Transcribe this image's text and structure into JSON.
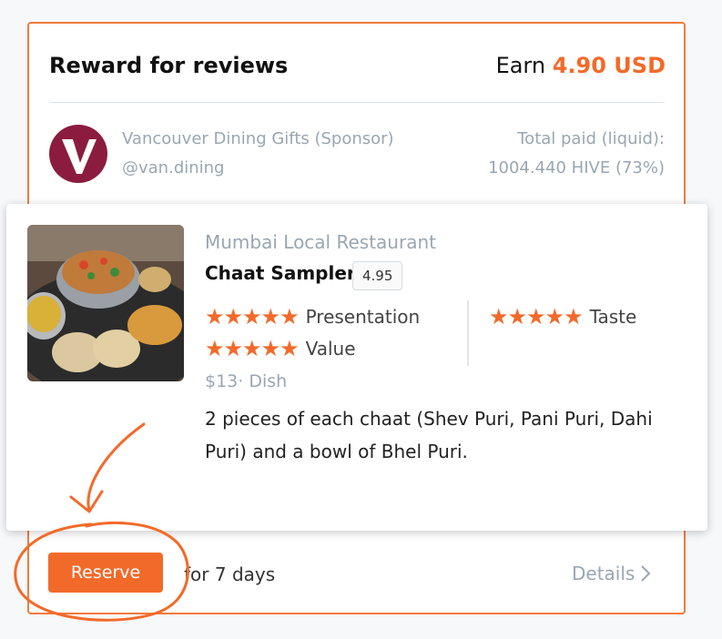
{
  "reward": {
    "title": "Reward for reviews",
    "earn_prefix": "Earn",
    "earn_amount": "4.90 USD"
  },
  "sponsor": {
    "name": "Vancouver Dining Gifts (Sponsor)",
    "handle": "@van.dining",
    "total_paid_label": "Total paid (liquid):",
    "total_paid_value": "1004.440 HIVE (73%)",
    "avatar_letter": "V"
  },
  "item": {
    "restaurant": "Mumbai Local Restaurant",
    "dish": "Chaat Sampler",
    "score": "4.95",
    "ratings": [
      {
        "label": "Presentation",
        "stars": 5
      },
      {
        "label": "Taste",
        "stars": 5
      },
      {
        "label": "Value",
        "stars": 5
      }
    ],
    "price": "$13",
    "separator": "·",
    "category": "Dish",
    "description": "2 pieces of each chaat (Shev Puri, Pani Puri, Dahi Puri) and a bowl of Bhel Puri."
  },
  "actions": {
    "reserve_label": "Reserve",
    "duration": "for 7 days",
    "details_label": "Details"
  },
  "colors": {
    "accent": "#f26a2a",
    "muted": "#9aa6b2",
    "avatar": "#8b1c3f"
  }
}
